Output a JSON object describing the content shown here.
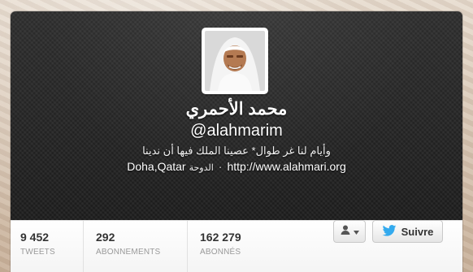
{
  "profile": {
    "name": "محمد الأحمري",
    "handle": "@alahmarim",
    "bio": "وأيام لنا غر طوال* عصينا الملك فيها أن ندينا",
    "location_latin": "Doha,Qatar",
    "location_arabic": "الدوحة",
    "separator": "·",
    "url": "http://www.alahmari.org"
  },
  "stats": [
    {
      "value": "9 452",
      "label": "TWEETS"
    },
    {
      "value": "292",
      "label": "ABONNEMENTS"
    },
    {
      "value": "162 279",
      "label": "ABONNÉS"
    }
  ],
  "actions": {
    "follow_label": "Suivre"
  },
  "icons": {
    "user_menu": "user-icon",
    "follow": "twitter-bird-icon"
  },
  "colors": {
    "header_bg": "#1f1f1f",
    "twitter_blue": "#33aaee",
    "text_white": "#ffffff"
  }
}
